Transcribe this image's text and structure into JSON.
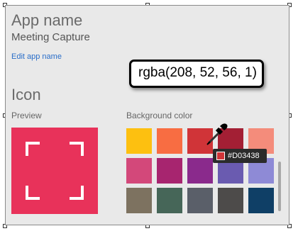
{
  "panel": {
    "app_name_label": "App name",
    "app_name_value": "Meeting Capture",
    "edit_link": "Edit app name",
    "icon_label": "Icon",
    "preview_label": "Preview",
    "background_label": "Background color"
  },
  "preview": {
    "color": "#e8325a",
    "icon": "corner-brackets-icon"
  },
  "swatches": [
    "#fdc010",
    "#f86d42",
    "#d03438",
    "#a31f34",
    "#f48c7b",
    "#d3487a",
    "#a7256f",
    "#8a2a8c",
    "#6a5bb0",
    "#8e8ad6",
    "#7d7260",
    "#466658",
    "#5a5f69",
    "#4d4b4a",
    "#0f3f66"
  ],
  "callout": {
    "text": "rgba(208, 52, 56, 1)"
  },
  "tooltip": {
    "text": "#D03438",
    "color": "#d03438"
  },
  "cursor": {
    "icon": "eyedropper-icon"
  }
}
